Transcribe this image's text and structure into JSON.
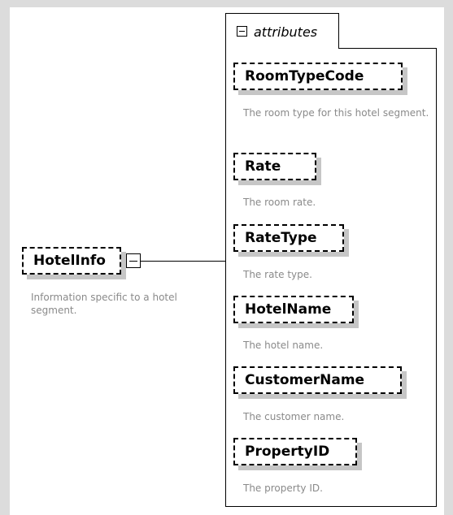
{
  "root": {
    "name": "HotelInfo",
    "description": "Information specific to a hotel segment."
  },
  "group": {
    "title": "attributes"
  },
  "attributes": [
    {
      "name": "RoomTypeCode",
      "description": "The room type for this hotel segment."
    },
    {
      "name": "Rate",
      "description": "The room rate."
    },
    {
      "name": "RateType",
      "description": "The rate type."
    },
    {
      "name": "HotelName",
      "description": "The hotel name."
    },
    {
      "name": "CustomerName",
      "description": "The customer name."
    },
    {
      "name": "PropertyID",
      "description": "The property ID."
    }
  ]
}
